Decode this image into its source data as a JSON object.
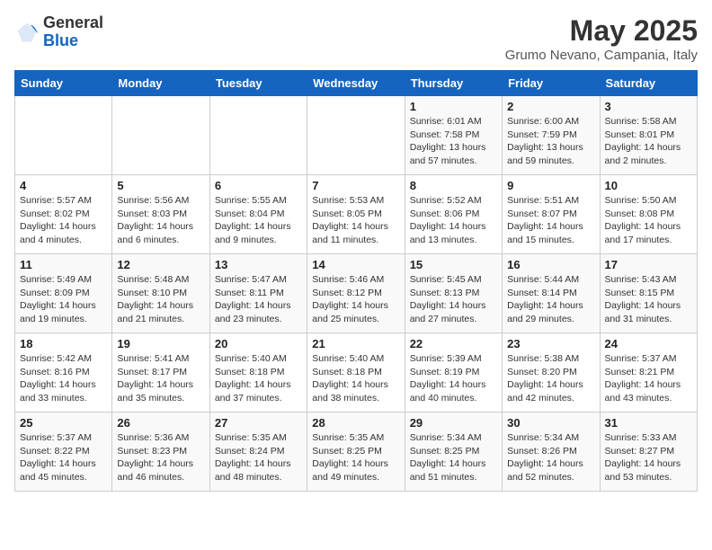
{
  "header": {
    "logo_general": "General",
    "logo_blue": "Blue",
    "title": "May 2025",
    "subtitle": "Grumo Nevano, Campania, Italy"
  },
  "weekdays": [
    "Sunday",
    "Monday",
    "Tuesday",
    "Wednesday",
    "Thursday",
    "Friday",
    "Saturday"
  ],
  "weeks": [
    [
      {
        "day": "",
        "info": ""
      },
      {
        "day": "",
        "info": ""
      },
      {
        "day": "",
        "info": ""
      },
      {
        "day": "",
        "info": ""
      },
      {
        "day": "1",
        "info": "Sunrise: 6:01 AM\nSunset: 7:58 PM\nDaylight: 13 hours\nand 57 minutes."
      },
      {
        "day": "2",
        "info": "Sunrise: 6:00 AM\nSunset: 7:59 PM\nDaylight: 13 hours\nand 59 minutes."
      },
      {
        "day": "3",
        "info": "Sunrise: 5:58 AM\nSunset: 8:01 PM\nDaylight: 14 hours\nand 2 minutes."
      }
    ],
    [
      {
        "day": "4",
        "info": "Sunrise: 5:57 AM\nSunset: 8:02 PM\nDaylight: 14 hours\nand 4 minutes."
      },
      {
        "day": "5",
        "info": "Sunrise: 5:56 AM\nSunset: 8:03 PM\nDaylight: 14 hours\nand 6 minutes."
      },
      {
        "day": "6",
        "info": "Sunrise: 5:55 AM\nSunset: 8:04 PM\nDaylight: 14 hours\nand 9 minutes."
      },
      {
        "day": "7",
        "info": "Sunrise: 5:53 AM\nSunset: 8:05 PM\nDaylight: 14 hours\nand 11 minutes."
      },
      {
        "day": "8",
        "info": "Sunrise: 5:52 AM\nSunset: 8:06 PM\nDaylight: 14 hours\nand 13 minutes."
      },
      {
        "day": "9",
        "info": "Sunrise: 5:51 AM\nSunset: 8:07 PM\nDaylight: 14 hours\nand 15 minutes."
      },
      {
        "day": "10",
        "info": "Sunrise: 5:50 AM\nSunset: 8:08 PM\nDaylight: 14 hours\nand 17 minutes."
      }
    ],
    [
      {
        "day": "11",
        "info": "Sunrise: 5:49 AM\nSunset: 8:09 PM\nDaylight: 14 hours\nand 19 minutes."
      },
      {
        "day": "12",
        "info": "Sunrise: 5:48 AM\nSunset: 8:10 PM\nDaylight: 14 hours\nand 21 minutes."
      },
      {
        "day": "13",
        "info": "Sunrise: 5:47 AM\nSunset: 8:11 PM\nDaylight: 14 hours\nand 23 minutes."
      },
      {
        "day": "14",
        "info": "Sunrise: 5:46 AM\nSunset: 8:12 PM\nDaylight: 14 hours\nand 25 minutes."
      },
      {
        "day": "15",
        "info": "Sunrise: 5:45 AM\nSunset: 8:13 PM\nDaylight: 14 hours\nand 27 minutes."
      },
      {
        "day": "16",
        "info": "Sunrise: 5:44 AM\nSunset: 8:14 PM\nDaylight: 14 hours\nand 29 minutes."
      },
      {
        "day": "17",
        "info": "Sunrise: 5:43 AM\nSunset: 8:15 PM\nDaylight: 14 hours\nand 31 minutes."
      }
    ],
    [
      {
        "day": "18",
        "info": "Sunrise: 5:42 AM\nSunset: 8:16 PM\nDaylight: 14 hours\nand 33 minutes."
      },
      {
        "day": "19",
        "info": "Sunrise: 5:41 AM\nSunset: 8:17 PM\nDaylight: 14 hours\nand 35 minutes."
      },
      {
        "day": "20",
        "info": "Sunrise: 5:40 AM\nSunset: 8:18 PM\nDaylight: 14 hours\nand 37 minutes."
      },
      {
        "day": "21",
        "info": "Sunrise: 5:40 AM\nSunset: 8:18 PM\nDaylight: 14 hours\nand 38 minutes."
      },
      {
        "day": "22",
        "info": "Sunrise: 5:39 AM\nSunset: 8:19 PM\nDaylight: 14 hours\nand 40 minutes."
      },
      {
        "day": "23",
        "info": "Sunrise: 5:38 AM\nSunset: 8:20 PM\nDaylight: 14 hours\nand 42 minutes."
      },
      {
        "day": "24",
        "info": "Sunrise: 5:37 AM\nSunset: 8:21 PM\nDaylight: 14 hours\nand 43 minutes."
      }
    ],
    [
      {
        "day": "25",
        "info": "Sunrise: 5:37 AM\nSunset: 8:22 PM\nDaylight: 14 hours\nand 45 minutes."
      },
      {
        "day": "26",
        "info": "Sunrise: 5:36 AM\nSunset: 8:23 PM\nDaylight: 14 hours\nand 46 minutes."
      },
      {
        "day": "27",
        "info": "Sunrise: 5:35 AM\nSunset: 8:24 PM\nDaylight: 14 hours\nand 48 minutes."
      },
      {
        "day": "28",
        "info": "Sunrise: 5:35 AM\nSunset: 8:25 PM\nDaylight: 14 hours\nand 49 minutes."
      },
      {
        "day": "29",
        "info": "Sunrise: 5:34 AM\nSunset: 8:25 PM\nDaylight: 14 hours\nand 51 minutes."
      },
      {
        "day": "30",
        "info": "Sunrise: 5:34 AM\nSunset: 8:26 PM\nDaylight: 14 hours\nand 52 minutes."
      },
      {
        "day": "31",
        "info": "Sunrise: 5:33 AM\nSunset: 8:27 PM\nDaylight: 14 hours\nand 53 minutes."
      }
    ]
  ]
}
